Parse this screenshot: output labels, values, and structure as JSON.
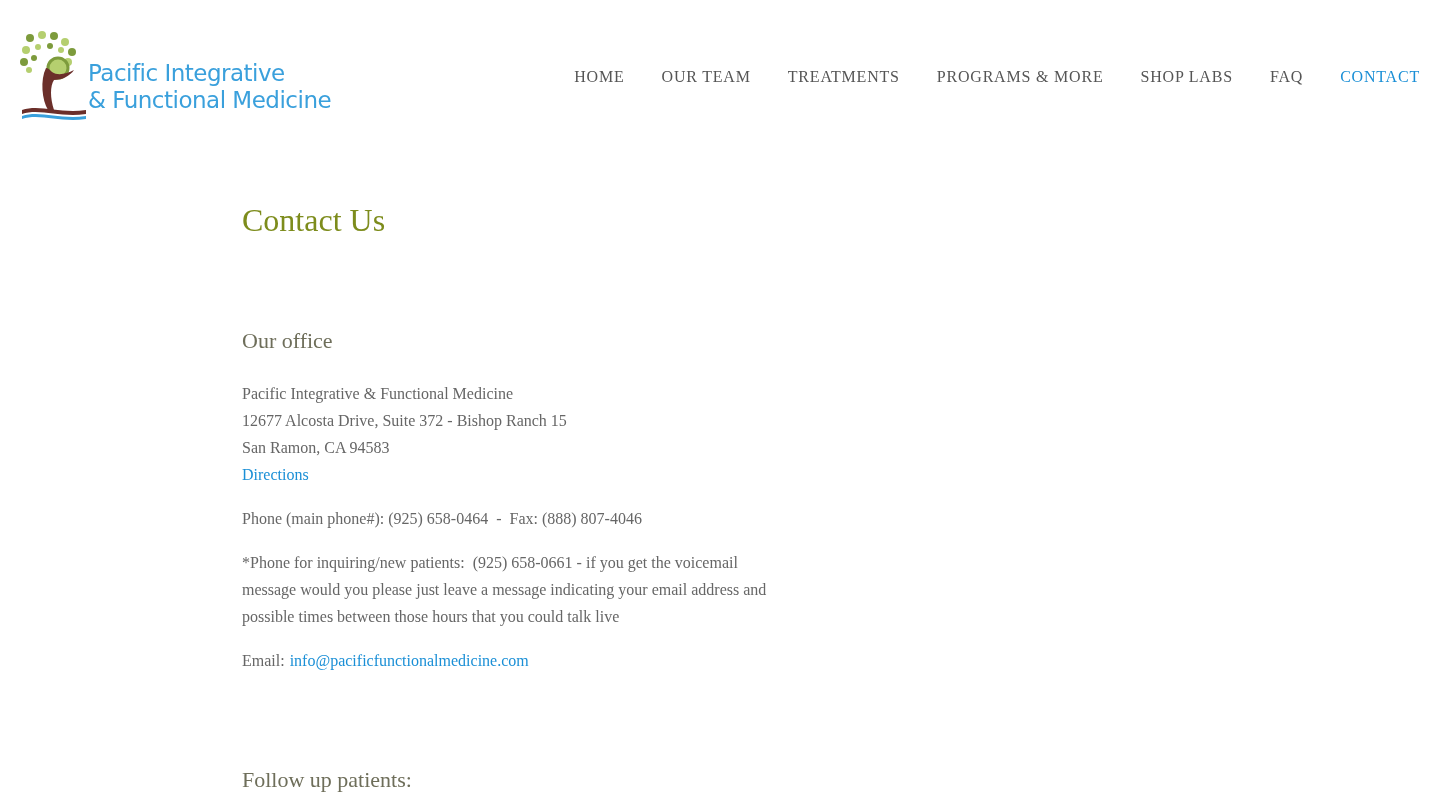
{
  "logo": {
    "line_1": "Pacific Integrative",
    "line_2": "& Functional Medicine"
  },
  "nav": [
    {
      "label": "HOME",
      "selected": false
    },
    {
      "label": "OUR TEAM",
      "selected": false
    },
    {
      "label": "TREATMENTS",
      "selected": false
    },
    {
      "label": "PROGRAMS & MORE",
      "selected": false
    },
    {
      "label": "SHOP LABS",
      "selected": false
    },
    {
      "label": "FAQ",
      "selected": false
    },
    {
      "label": "CONTACT",
      "selected": true
    }
  ],
  "title": "Contact Us",
  "office": {
    "heading": "Our office",
    "address": [
      "Pacific Integrative & Functional Medicine",
      "12677 Alcosta Drive, Suite 372 - Bishop Ranch 15",
      "San Ramon, CA 94583"
    ],
    "directions_link": "Directions",
    "phone": "Phone (main phone#): (925) 658-0464  -  Fax: (888) 807-4046",
    "new_patients": "*Phone for inquiring/new patients:  (925) 658-0661 - if you get the voicemail message would you please just leave a message indicating your email address and possible times between those hours that you could talk live",
    "email_label": "Email:",
    "email_link": "info@pacificfunctionalmedicine.com"
  },
  "follow_up": {
    "heading": "Follow up patients:"
  }
}
